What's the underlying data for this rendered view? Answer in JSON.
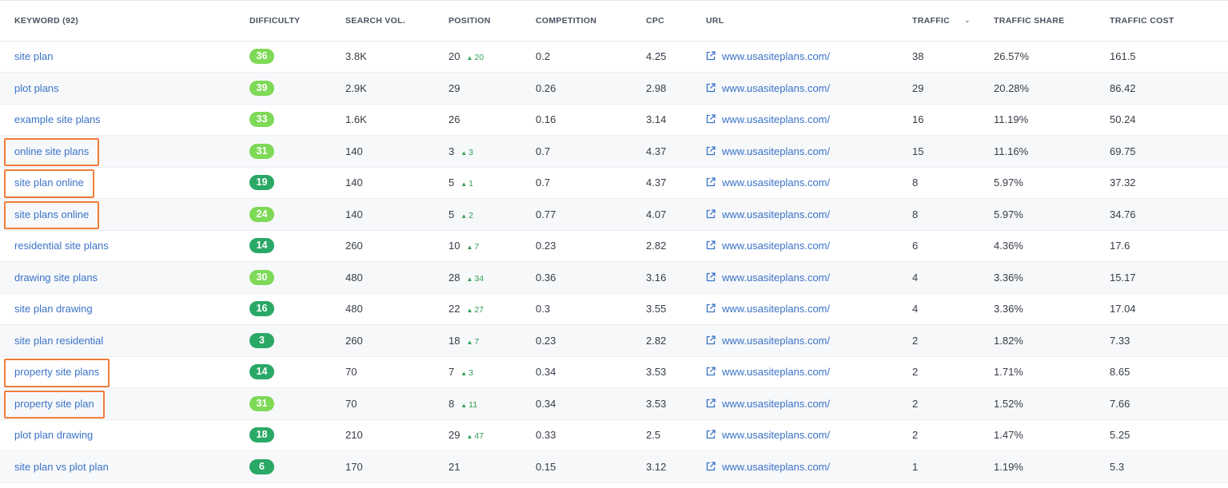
{
  "columns": {
    "keyword": "KEYWORD",
    "keyword_count": "(92)",
    "difficulty": "DIFFICULTY",
    "search_vol": "SEARCH VOL.",
    "position": "POSITION",
    "competition": "COMPETITION",
    "cpc": "CPC",
    "url": "URL",
    "traffic": "TRAFFIC",
    "traffic_share": "TRAFFIC SHARE",
    "traffic_cost": "TRAFFIC COST"
  },
  "sort_icon": "chevron-down-icon",
  "url_icon": "external-link-icon",
  "colors": {
    "link": "#3a73c7",
    "badge_light": "#7ed957",
    "badge_dark": "#2aa866",
    "delta_up": "#2f9e55",
    "highlight": "#f07d3a"
  },
  "rows": [
    {
      "keyword": "site plan",
      "difficulty": "36",
      "diff_level": "light",
      "search_vol": "3.8K",
      "position": "20",
      "delta": "20",
      "competition": "0.2",
      "cpc": "4.25",
      "url": "www.usasiteplans.com/",
      "traffic": "38",
      "traffic_share": "26.57%",
      "traffic_cost": "161.5",
      "highlighted": false
    },
    {
      "keyword": "plot plans",
      "difficulty": "39",
      "diff_level": "light",
      "search_vol": "2.9K",
      "position": "29",
      "delta": "",
      "competition": "0.26",
      "cpc": "2.98",
      "url": "www.usasiteplans.com/",
      "traffic": "29",
      "traffic_share": "20.28%",
      "traffic_cost": "86.42",
      "highlighted": false
    },
    {
      "keyword": "example site plans",
      "difficulty": "33",
      "diff_level": "light",
      "search_vol": "1.6K",
      "position": "26",
      "delta": "",
      "competition": "0.16",
      "cpc": "3.14",
      "url": "www.usasiteplans.com/",
      "traffic": "16",
      "traffic_share": "11.19%",
      "traffic_cost": "50.24",
      "highlighted": false
    },
    {
      "keyword": "online site plans",
      "difficulty": "31",
      "diff_level": "light",
      "search_vol": "140",
      "position": "3",
      "delta": "3",
      "competition": "0.7",
      "cpc": "4.37",
      "url": "www.usasiteplans.com/",
      "traffic": "15",
      "traffic_share": "11.16%",
      "traffic_cost": "69.75",
      "highlighted": true
    },
    {
      "keyword": "site plan online",
      "difficulty": "19",
      "diff_level": "dark",
      "search_vol": "140",
      "position": "5",
      "delta": "1",
      "competition": "0.7",
      "cpc": "4.37",
      "url": "www.usasiteplans.com/",
      "traffic": "8",
      "traffic_share": "5.97%",
      "traffic_cost": "37.32",
      "highlighted": true
    },
    {
      "keyword": "site plans online",
      "difficulty": "24",
      "diff_level": "light",
      "search_vol": "140",
      "position": "5",
      "delta": "2",
      "competition": "0.77",
      "cpc": "4.07",
      "url": "www.usasiteplans.com/",
      "traffic": "8",
      "traffic_share": "5.97%",
      "traffic_cost": "34.76",
      "highlighted": true
    },
    {
      "keyword": "residential site plans",
      "difficulty": "14",
      "diff_level": "dark",
      "search_vol": "260",
      "position": "10",
      "delta": "7",
      "competition": "0.23",
      "cpc": "2.82",
      "url": "www.usasiteplans.com/",
      "traffic": "6",
      "traffic_share": "4.36%",
      "traffic_cost": "17.6",
      "highlighted": false
    },
    {
      "keyword": "drawing site plans",
      "difficulty": "30",
      "diff_level": "light",
      "search_vol": "480",
      "position": "28",
      "delta": "34",
      "competition": "0.36",
      "cpc": "3.16",
      "url": "www.usasiteplans.com/",
      "traffic": "4",
      "traffic_share": "3.36%",
      "traffic_cost": "15.17",
      "highlighted": false
    },
    {
      "keyword": "site plan drawing",
      "difficulty": "16",
      "diff_level": "dark",
      "search_vol": "480",
      "position": "22",
      "delta": "27",
      "competition": "0.3",
      "cpc": "3.55",
      "url": "www.usasiteplans.com/",
      "traffic": "4",
      "traffic_share": "3.36%",
      "traffic_cost": "17.04",
      "highlighted": false
    },
    {
      "keyword": "site plan residential",
      "difficulty": "3",
      "diff_level": "dark",
      "search_vol": "260",
      "position": "18",
      "delta": "7",
      "competition": "0.23",
      "cpc": "2.82",
      "url": "www.usasiteplans.com/",
      "traffic": "2",
      "traffic_share": "1.82%",
      "traffic_cost": "7.33",
      "highlighted": false
    },
    {
      "keyword": "property site plans",
      "difficulty": "14",
      "diff_level": "dark",
      "search_vol": "70",
      "position": "7",
      "delta": "3",
      "competition": "0.34",
      "cpc": "3.53",
      "url": "www.usasiteplans.com/",
      "traffic": "2",
      "traffic_share": "1.71%",
      "traffic_cost": "8.65",
      "highlighted": true
    },
    {
      "keyword": "property site plan",
      "difficulty": "31",
      "diff_level": "light",
      "search_vol": "70",
      "position": "8",
      "delta": "11",
      "competition": "0.34",
      "cpc": "3.53",
      "url": "www.usasiteplans.com/",
      "traffic": "2",
      "traffic_share": "1.52%",
      "traffic_cost": "7.66",
      "highlighted": true
    },
    {
      "keyword": "plot plan drawing",
      "difficulty": "18",
      "diff_level": "dark",
      "search_vol": "210",
      "position": "29",
      "delta": "47",
      "competition": "0.33",
      "cpc": "2.5",
      "url": "www.usasiteplans.com/",
      "traffic": "2",
      "traffic_share": "1.47%",
      "traffic_cost": "5.25",
      "highlighted": false
    },
    {
      "keyword": "site plan vs plot plan",
      "difficulty": "6",
      "diff_level": "dark",
      "search_vol": "170",
      "position": "21",
      "delta": "",
      "competition": "0.15",
      "cpc": "3.12",
      "url": "www.usasiteplans.com/",
      "traffic": "1",
      "traffic_share": "1.19%",
      "traffic_cost": "5.3",
      "highlighted": false
    }
  ]
}
